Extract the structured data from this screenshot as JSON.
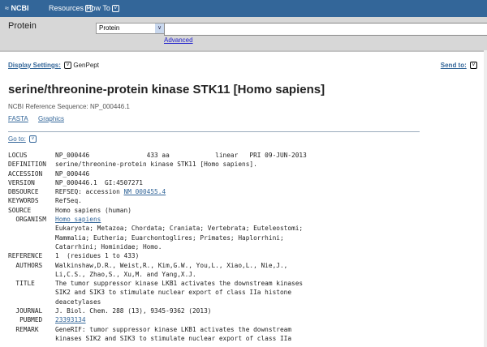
{
  "topbar": {
    "logo": "NCBI",
    "resources": "Resources",
    "howto": "How To"
  },
  "search": {
    "db_label": "Protein",
    "db_selected": "Protein",
    "query": "",
    "advanced": "Advanced"
  },
  "display": {
    "label": "Display Settings:",
    "value": "GenPept",
    "send_to": "Send to:"
  },
  "title": "serine/threonine-protein kinase STK11 [Homo sapiens]",
  "refseq": "NCBI Reference Sequence: NP_000446.1",
  "formats": [
    "FASTA",
    "Graphics"
  ],
  "goto": "Go to:",
  "record": [
    {
      "label": "LOCUS",
      "text": "NP_000446               433 aa            linear   PRI 09-JUN-2013"
    },
    {
      "label": "DEFINITION",
      "text": "serine/threonine-protein kinase STK11 [Homo sapiens]."
    },
    {
      "label": "ACCESSION",
      "text": "NP_000446"
    },
    {
      "label": "VERSION",
      "text": "NP_000446.1  GI:4507271"
    },
    {
      "label": "DBSOURCE",
      "text": "REFSEQ: accession ",
      "link": "NM_000455.4"
    },
    {
      "label": "KEYWORDS",
      "text": "RefSeq."
    },
    {
      "label": "SOURCE",
      "text": "Homo sapiens (human)"
    },
    {
      "label": "  ORGANISM",
      "text": "",
      "link": "Homo sapiens"
    },
    {
      "label": "",
      "text": "Eukaryota; Metazoa; Chordata; Craniata; Vertebrata; Euteleostomi;"
    },
    {
      "label": "",
      "text": "Mammalia; Eutheria; Euarchontoglires; Primates; Haplorrhini;"
    },
    {
      "label": "",
      "text": "Catarrhini; Hominidae; Homo."
    },
    {
      "label": "REFERENCE",
      "text": "1  (residues 1 to 433)"
    },
    {
      "label": "  AUTHORS",
      "text": "Walkinshaw,D.R., Weist,R., Kim,G.W., You,L., Xiao,L., Nie,J.,"
    },
    {
      "label": "",
      "text": "Li,C.S., Zhao,S., Xu,M. and Yang,X.J."
    },
    {
      "label": "  TITLE",
      "text": "The tumor suppressor kinase LKB1 activates the downstream kinases"
    },
    {
      "label": "",
      "text": "SIK2 and SIK3 to stimulate nuclear export of class IIa histone"
    },
    {
      "label": "",
      "text": "deacetylases"
    },
    {
      "label": "  JOURNAL",
      "text": "J. Biol. Chem. 288 (13), 9345-9362 (2013)"
    },
    {
      "label": "   PUBMED",
      "text": "",
      "link": "23393134"
    },
    {
      "label": "  REMARK",
      "text": "GeneRIF: tumor suppressor kinase LKB1 activates the downstream"
    },
    {
      "label": "",
      "text": "kinases SIK2 and SIK3 to stimulate nuclear export of class IIa"
    }
  ]
}
